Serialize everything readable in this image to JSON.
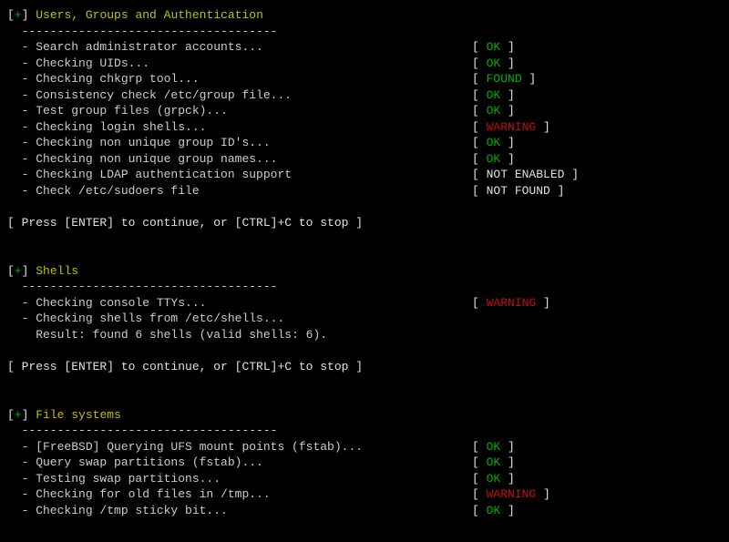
{
  "sections": [
    {
      "title": "Users, Groups and Authentication",
      "sep": "  ------------------------------------",
      "items": [
        {
          "desc": "  - Search administrator accounts...",
          "status": "OK",
          "color": "green"
        },
        {
          "desc": "  - Checking UIDs...",
          "status": "OK",
          "color": "green"
        },
        {
          "desc": "  - Checking chkgrp tool...",
          "status": "FOUND",
          "color": "green"
        },
        {
          "desc": "  - Consistency check /etc/group file...",
          "status": "OK",
          "color": "green"
        },
        {
          "desc": "  - Test group files (grpck)...",
          "status": "OK",
          "color": "green"
        },
        {
          "desc": "  - Checking login shells...",
          "status": "WARNING",
          "color": "red"
        },
        {
          "desc": "  - Checking non unique group ID's...",
          "status": "OK",
          "color": "green"
        },
        {
          "desc": "  - Checking non unique group names...",
          "status": "OK",
          "color": "green"
        },
        {
          "desc": "  - Checking LDAP authentication support",
          "status": "NOT ENABLED",
          "color": "white"
        },
        {
          "desc": "  - Check /etc/sudoers file",
          "status": "NOT FOUND",
          "color": "white"
        }
      ],
      "prompt": "[ Press [ENTER] to continue, or [CTRL]+C to stop ]"
    },
    {
      "title": "Shells",
      "sep": "  ------------------------------------",
      "items": [
        {
          "desc": "  - Checking console TTYs...",
          "status": "WARNING",
          "color": "red"
        },
        {
          "desc": "  - Checking shells from /etc/shells...",
          "status": "",
          "color": ""
        },
        {
          "desc": "    Result: found 6 shells (valid shells: 6).",
          "status": "",
          "color": ""
        }
      ],
      "prompt": "[ Press [ENTER] to continue, or [CTRL]+C to stop ]"
    },
    {
      "title": "File systems",
      "sep": "  ------------------------------------",
      "items": [
        {
          "desc": "  - [FreeBSD] Querying UFS mount points (fstab)...",
          "status": "OK",
          "color": "green"
        },
        {
          "desc": "  - Query swap partitions (fstab)...",
          "status": "OK",
          "color": "green"
        },
        {
          "desc": "  - Testing swap partitions...",
          "status": "OK",
          "color": "green"
        },
        {
          "desc": "  - Checking for old files in /tmp...",
          "status": "WARNING",
          "color": "red"
        },
        {
          "desc": "  - Checking /tmp sticky bit...",
          "status": "OK",
          "color": "green"
        }
      ],
      "prompt": ""
    }
  ]
}
